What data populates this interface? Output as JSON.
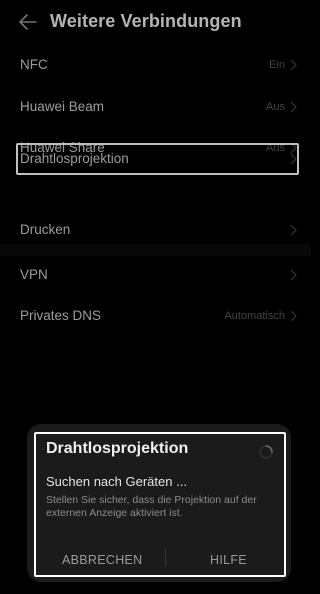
{
  "header": {
    "title": "Weitere Verbindungen"
  },
  "settings": {
    "nfc": {
      "label": "NFC",
      "value": "Ein"
    },
    "huawei_beam": {
      "label": "Huawei Beam",
      "value": "Aus"
    },
    "huawei_share": {
      "label": "Huawei Share",
      "value": "Aus"
    },
    "drahtlosprojektion": {
      "label": "Drahtlosprojektion",
      "value": ""
    },
    "drucken": {
      "label": "Drucken",
      "value": ""
    },
    "vpn": {
      "label": "VPN",
      "value": ""
    },
    "privates_dns": {
      "label": "Privates DNS",
      "value": "Automatisch"
    }
  },
  "dialog": {
    "title": "Drahtlosprojektion",
    "status": "Suchen nach Geräten ...",
    "message": "Stellen Sie sicher, dass die Projektion auf der externen Anzeige aktiviert ist.",
    "cancel_label": "ABBRECHEN",
    "help_label": "HILFE"
  },
  "icons": {
    "back": "arrow-left-icon",
    "chevron": "chevron-right-icon",
    "spinner": "loading-spinner-icon"
  }
}
